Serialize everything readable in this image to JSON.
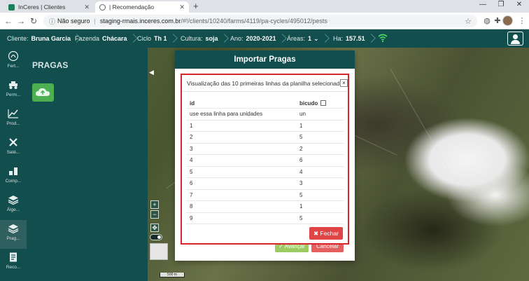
{
  "browser": {
    "tabs": [
      {
        "title": "InCeres | Clientes",
        "favicon_color": "#1a7f5a"
      },
      {
        "title": "| Recomendação",
        "favicon_color": "#5f6368"
      }
    ],
    "new_tab": "+",
    "address": {
      "security": "Não seguro",
      "host": "staging-rmais.inceres.com.br",
      "path": "/#!/clients/10240/farms/4119/pa-cycles/495012/pests"
    }
  },
  "header": {
    "items": [
      {
        "label": "Cliente:",
        "value": "Bruna Garcia"
      },
      {
        "label": "Fazenda",
        "value": "Chácara"
      },
      {
        "label": "Ciclo",
        "value": "Th 1"
      },
      {
        "label": "Cultura:",
        "value": "soja"
      },
      {
        "label": "Ano:",
        "value": "2020-2021"
      },
      {
        "label": "Áreas:",
        "value": "1"
      },
      {
        "label": "Ha:",
        "value": "157.51"
      }
    ],
    "areas_dropdown": "⌄",
    "accent_color": "#124e4d",
    "wifi_color": "#4cd964"
  },
  "sidebar": {
    "items": [
      {
        "label": "Fert...",
        "icon": "fertilizer-icon"
      },
      {
        "label": "Perm...",
        "icon": "tractor-icon"
      },
      {
        "label": "Prod...",
        "icon": "chart-icon"
      },
      {
        "label": "Saté...",
        "icon": "satellite-icon"
      },
      {
        "label": "Comp...",
        "icon": "compare-icon"
      },
      {
        "label": "Álge...",
        "icon": "layers-icon"
      },
      {
        "label": "Prag...",
        "icon": "layers-icon"
      },
      {
        "label": "Reco...",
        "icon": "document-icon"
      }
    ],
    "active_index": 6
  },
  "panel": {
    "title": "PRAGAS",
    "collapse": "◀"
  },
  "map_controls": {
    "zoom_in": "+",
    "zoom_out": "−",
    "fullscreen": "✥",
    "scale": "500 m"
  },
  "modal": {
    "title": "Importar Pragas",
    "behind_ok": "✓ Avançar",
    "behind_cancel": "Cancelar",
    "preview": {
      "heading": "Visualização das 10 primeiras linhas da planilha selecionada.",
      "close": "×",
      "columns": [
        "id",
        "bicudo"
      ],
      "rows": [
        [
          "use essa linha para unidades",
          "un"
        ],
        [
          "1",
          "1"
        ],
        [
          "2",
          "5"
        ],
        [
          "3",
          "2"
        ],
        [
          "4",
          "6"
        ],
        [
          "5",
          "4"
        ],
        [
          "6",
          "3"
        ],
        [
          "7",
          "5"
        ],
        [
          "8",
          "1"
        ],
        [
          "9",
          "5"
        ]
      ],
      "fechar": "✖ Fechar"
    },
    "highlight_color": "#d9262b",
    "danger_color": "#e04545"
  }
}
